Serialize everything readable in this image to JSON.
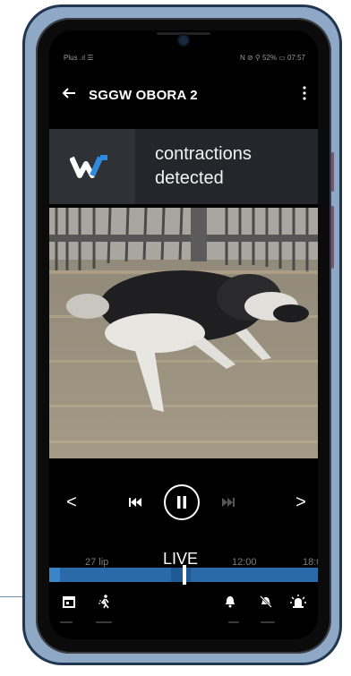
{
  "statusbar": {
    "left": "Plus .ıl ☰",
    "right": "N ⊘ ⚲ 52% ▭ 07:57"
  },
  "header": {
    "back_icon": "arrow-left",
    "title": "SGGW OBORA 2",
    "menu_icon": "more-vertical"
  },
  "notification": {
    "logo": "W",
    "line1": "contractions",
    "line2": "detected"
  },
  "player": {
    "prev_day": "<",
    "next_day": ">"
  },
  "timeline": {
    "left_label": "27 lip",
    "live_label": "LIVE",
    "time_label": "12:00",
    "time_label_2": "18:0"
  },
  "colors": {
    "frame": "#8fa8c6",
    "timeline": "#2a6aa8",
    "notification_bg": "#23262b"
  }
}
